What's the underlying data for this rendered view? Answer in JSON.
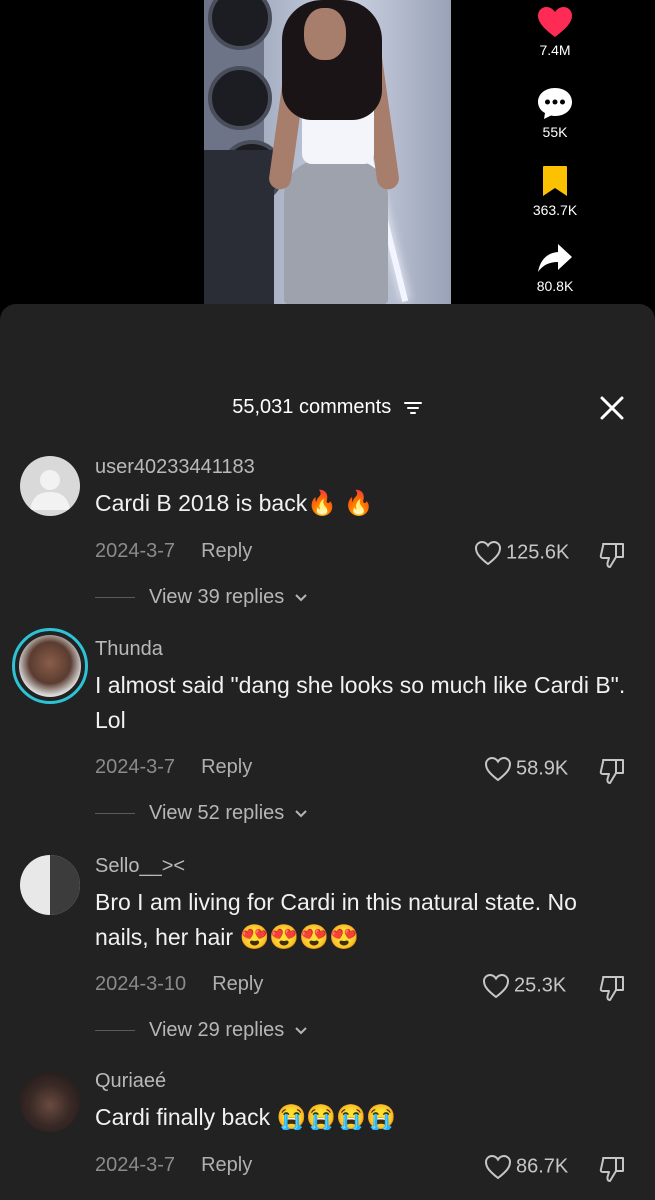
{
  "video": {
    "likes": "7.4M",
    "comments": "55K",
    "saves": "363.7K",
    "shares": "80.8K"
  },
  "sheet": {
    "comment_count": "55,031 comments"
  },
  "comments": [
    {
      "username": "user40233441183",
      "text": "Cardi B 2018 is back",
      "emojis": "🔥 🔥",
      "date": "2024-3-7",
      "reply_label": "Reply",
      "likes": "125.6K",
      "view_replies": "View 39 replies"
    },
    {
      "username": "Thunda",
      "text": "I almost said \"dang she looks so much like Cardi B\". Lol",
      "date": "2024-3-7",
      "reply_label": "Reply",
      "likes": "58.9K",
      "view_replies": "View 52 replies"
    },
    {
      "username": "Sello__><",
      "text": "Bro I am living for Cardi in this natural state. No nails, her hair",
      "emojis": "😍😍😍😍",
      "date": "2024-3-10",
      "reply_label": "Reply",
      "likes": "25.3K",
      "view_replies": "View 29 replies"
    },
    {
      "username": "Quriaeé",
      "text": "Cardi finally back",
      "emojis": "😭😭😭😭",
      "date": "2024-3-7",
      "reply_label": "Reply",
      "likes": "86.7K"
    }
  ],
  "colors": {
    "like_red": "#fe2c55",
    "save_yellow": "#fcc100",
    "sheet_bg": "#222222"
  }
}
